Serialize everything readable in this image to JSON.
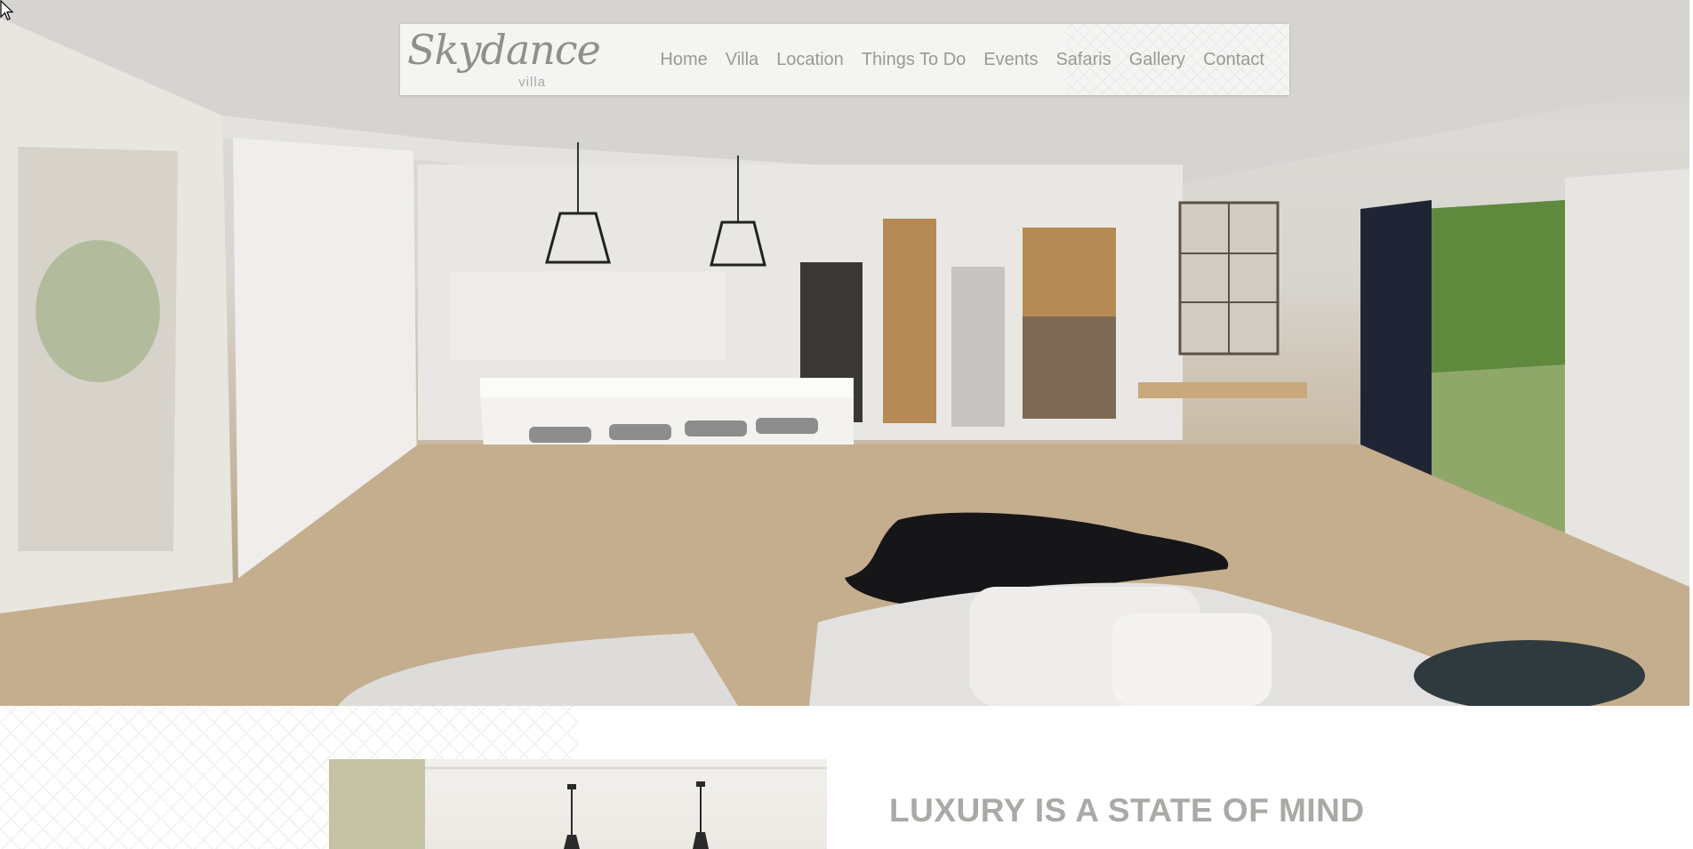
{
  "site": {
    "logo_text": "Skydance",
    "logo_subtext": "villa"
  },
  "nav": {
    "items": [
      {
        "label": "Home"
      },
      {
        "label": "Villa"
      },
      {
        "label": "Location"
      },
      {
        "label": "Things To Do"
      },
      {
        "label": "Events"
      },
      {
        "label": "Safaris"
      },
      {
        "label": "Gallery"
      },
      {
        "label": "Contact"
      }
    ]
  },
  "intro": {
    "heading": "LUXURY IS A STATE OF MIND"
  },
  "colors": {
    "nav_bg": "#f4f4f3",
    "nav_text": "#999995",
    "logo": "#8f8f8c",
    "heading": "#a9a9a5",
    "accent": "#c5c3a3"
  },
  "icons": {
    "cursor": "arrow-cursor-icon"
  }
}
